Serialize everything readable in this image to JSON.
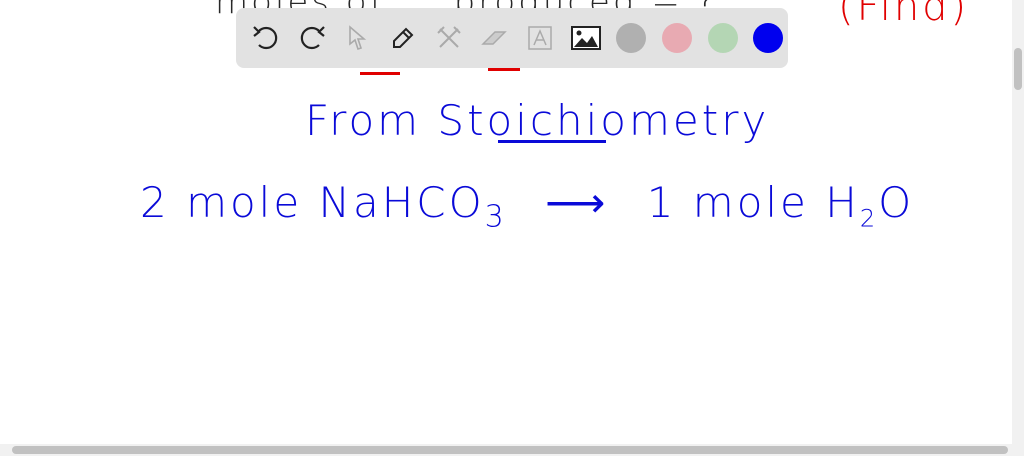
{
  "canvas": {
    "top_line_partial": "moles of ... produced = ?",
    "top_find": "(Find)",
    "line1": "From Stoichiometry",
    "line2_left": "2 mole NaHCO",
    "line2_left_sub": "3",
    "arrow": "⟶",
    "line2_right": "1 mole H",
    "line2_right_sub": "2",
    "line2_right_end": "O"
  },
  "toolbar": {
    "tools": [
      "undo-icon",
      "redo-icon",
      "select-icon",
      "pen-icon",
      "tools-icon",
      "eraser-icon",
      "text-icon",
      "image-icon"
    ],
    "colors": [
      "#b0b0b0",
      "#e8aab2",
      "#b4d6b4",
      "#0000ee"
    ],
    "selected_color": "#0000ee"
  }
}
